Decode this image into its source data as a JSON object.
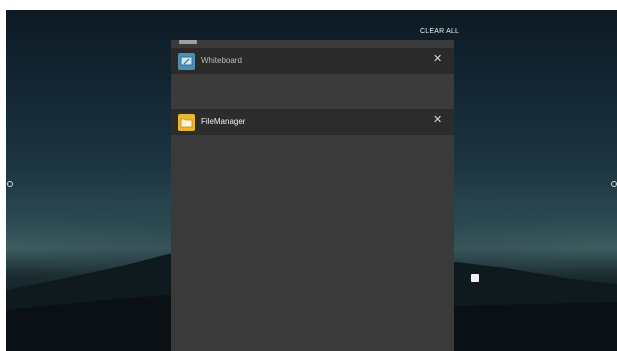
{
  "recents": {
    "clear_all_label": "CLEAR ALL",
    "apps": [
      {
        "title": "Whiteboard",
        "icon": "whiteboard-icon",
        "close_icon": "close-icon"
      },
      {
        "title": "FileManager",
        "icon": "folder-icon",
        "close_icon": "close-icon"
      }
    ]
  },
  "colors": {
    "panel_bg": "#3a3a3a",
    "header_bg": "#2b2b2b",
    "whiteboard_icon": "#4d8fb3",
    "filemanager_icon": "#e9b82e"
  }
}
